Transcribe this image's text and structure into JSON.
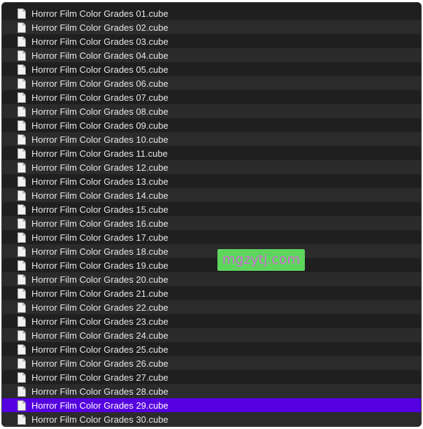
{
  "file_list": {
    "selected_index": 28,
    "items": [
      "Horror Film Color Grades 01.cube",
      "Horror Film Color Grades 02.cube",
      "Horror Film Color Grades 03.cube",
      "Horror Film Color Grades 04.cube",
      "Horror Film Color Grades 05.cube",
      "Horror Film Color Grades 06.cube",
      "Horror Film Color Grades 07.cube",
      "Horror Film Color Grades 08.cube",
      "Horror Film Color Grades 09.cube",
      "Horror Film Color Grades 10.cube",
      "Horror Film Color Grades 11.cube",
      "Horror Film Color Grades 12.cube",
      "Horror Film Color Grades 13.cube",
      "Horror Film Color Grades 14.cube",
      "Horror Film Color Grades 15.cube",
      "Horror Film Color Grades 16.cube",
      "Horror Film Color Grades 17.cube",
      "Horror Film Color Grades 18.cube",
      "Horror Film Color Grades 19.cube",
      "Horror Film Color Grades 20.cube",
      "Horror Film Color Grades 21.cube",
      "Horror Film Color Grades 22.cube",
      "Horror Film Color Grades 23.cube",
      "Horror Film Color Grades 24.cube",
      "Horror Film Color Grades 25.cube",
      "Horror Film Color Grades 26.cube",
      "Horror Film Color Grades 27.cube",
      "Horror Film Color Grades 28.cube",
      "Horror Film Color Grades 29.cube",
      "Horror Film Color Grades 30.cube"
    ],
    "icon": "document-icon"
  },
  "watermark": {
    "text": "mgzytj.com"
  },
  "colors": {
    "selection": "#5500e0",
    "row_dark": "#1f1f1f",
    "row_alt": "#2b2b2b",
    "watermark_bg": "#5ed65e",
    "watermark_text": "#d16ad7"
  }
}
